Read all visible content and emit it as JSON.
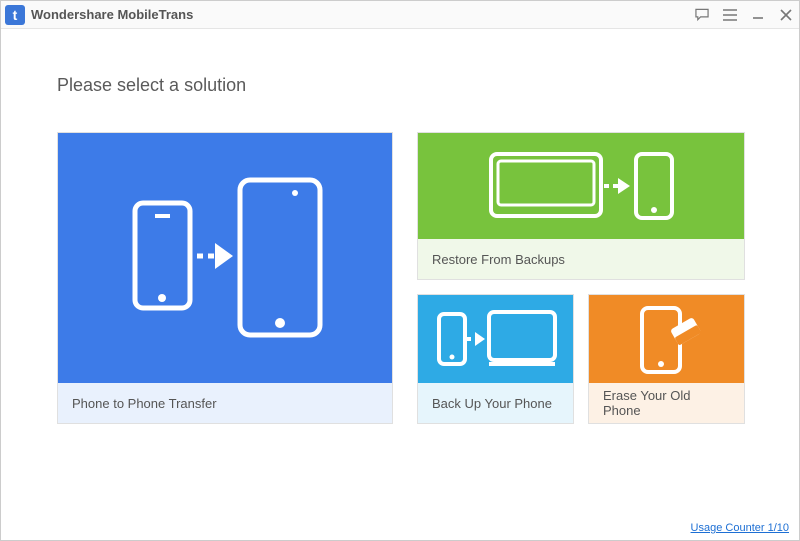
{
  "app": {
    "title": "Wondershare MobileTrans"
  },
  "heading": "Please select a solution",
  "tiles": {
    "transfer": "Phone to Phone Transfer",
    "restore": "Restore From Backups",
    "backup": "Back Up Your Phone",
    "erase": "Erase Your Old Phone"
  },
  "footer": {
    "usage": "Usage Counter 1/10"
  },
  "colors": {
    "blue": "#3d7be8",
    "green": "#78c33d",
    "cyan": "#2eaae5",
    "orange": "#f08b26"
  }
}
